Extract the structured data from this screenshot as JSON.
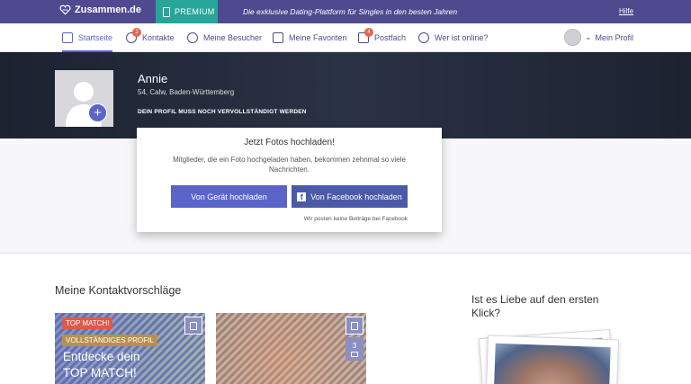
{
  "topbar": {
    "logo_text": "Zusammen.de",
    "premium_label": "PREMIUM",
    "tagline": "Die exklusive Dating-Plattform für Singles in den besten Jahren",
    "help_link": "Hilfe"
  },
  "nav": {
    "items": [
      {
        "label": "Startseite",
        "icon": "home-icon",
        "active": true
      },
      {
        "label": "Kontakte",
        "icon": "contacts-icon",
        "badge": "2"
      },
      {
        "label": "Meine Besucher",
        "icon": "eye-icon"
      },
      {
        "label": "Meine Favoriten",
        "icon": "favorites-icon"
      },
      {
        "label": "Postfach",
        "icon": "mail-icon",
        "badge": "4"
      },
      {
        "label": "Wer ist online?",
        "icon": "online-icon"
      }
    ],
    "profile_label": "Mein Profil"
  },
  "profile": {
    "name": "Annie",
    "location": "54, Calw, Baden-Württemberg",
    "notice": "DEIN PROFIL MUSS NOCH VERVOLLSTÄNDIGT WERDEN"
  },
  "upload": {
    "title": "Jetzt Fotos hochladen!",
    "text": "Mitglieder, die ein Foto hochgeladen haben, bekommen zehnmal so viele Nachrichten.",
    "device_button": "Von Gerät hochladen",
    "facebook_button": "Von Facebook hochladen",
    "facebook_note": "Wir posten keine Beiträge bei Facebook"
  },
  "suggestions": {
    "title": "Meine Kontaktvorschläge",
    "card1": {
      "tag_top": "TOP MATCH!",
      "tag_complete": "VOLLSTÄNDIGES PROFIL",
      "line1": "Entdecke dein",
      "line2": "TOP MATCH!"
    },
    "card2": {
      "photo_count": "3"
    }
  },
  "sidebar": {
    "title": "Ist es Liebe auf den ersten Klick?"
  },
  "colors": {
    "brand": "#4f4a8f",
    "premium": "#25a699",
    "accent": "#5a66c6",
    "badge": "#e8654c"
  }
}
